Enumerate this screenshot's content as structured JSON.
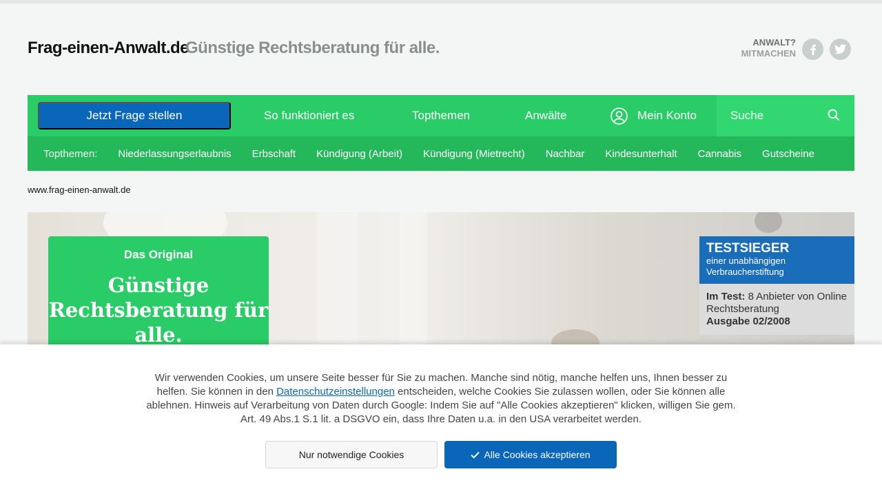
{
  "header": {
    "logo": "Frag-einen-Anwalt.de",
    "claim": "Günstige Rechtsberatung für alle.",
    "lawyer_link": {
      "line1": "ANWALT?",
      "line2": "MITMACHEN"
    },
    "social": [
      "facebook-icon",
      "twitter-icon"
    ]
  },
  "nav": {
    "ask_button": "Jetzt Frage stellen",
    "items": [
      "So funktioniert es",
      "Topthemen",
      "Anwälte"
    ],
    "account": "Mein Konto",
    "search_placeholder": "Suche"
  },
  "subnav": {
    "label": "Topthemen:",
    "topics": [
      "Niederlassungserlaubnis",
      "Erbschaft",
      "Kündigung (Arbeit)",
      "Kündigung (Mietrecht)",
      "Nachbar",
      "Kindesunterhalt",
      "Cannabis",
      "Gutscheine"
    ]
  },
  "breadcrumb": "www.frag-einen-anwalt.de",
  "promo": {
    "kicker": "Das Original",
    "title": "Günstige Rechtsberatung für alle."
  },
  "badge": {
    "title": "TESTSIEGER",
    "subtitle": "einer unabhängigen Verbraucherstiftung",
    "test_label": "Im Test:",
    "test_text": "8 Anbieter von Online Rechtsberatung",
    "issue": "Ausgabe 02/2008"
  },
  "cookie": {
    "text_before": "Wir verwenden Cookies, um unsere Seite besser für Sie zu machen. Manche sind nötig, manche helfen uns, Ihnen besser zu helfen. Sie können in den ",
    "link": "Datenschutzeinstellungen",
    "text_after": " entscheiden, welche Cookies Sie zulassen wollen, oder Sie können alle ablehnen. Hinweis auf Verarbeitung von Daten durch Google: Indem Sie auf \"Alle Cookies akzeptieren\" klicken, willigen Sie gem. Art. 49 Abs.1 S.1 lit. a DSGVO ein, dass Ihre Daten u.a. in den USA verarbeitet werden.",
    "btn_necessary": "Nur notwendige Cookies",
    "btn_accept": "Alle Cookies akzeptieren"
  },
  "colors": {
    "green": "#29cc66",
    "green_dark": "#24b85b",
    "blue": "#0a66b8"
  }
}
